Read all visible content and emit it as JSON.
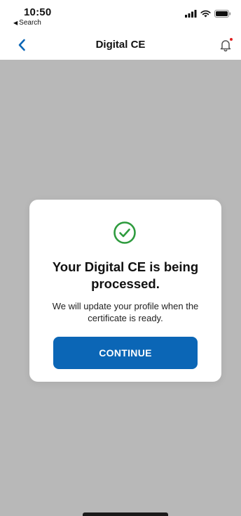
{
  "status_bar": {
    "time": "10:50",
    "back_to_app": "Search",
    "icons": [
      "signal-icon",
      "wifi-icon",
      "battery-icon"
    ]
  },
  "nav": {
    "title": "Digital CE",
    "back_icon": "chevron-left-icon",
    "bell_icon": "bell-icon",
    "has_notification": true
  },
  "modal": {
    "icon": "check-circle-icon",
    "title": "Your Digital CE is being processed.",
    "message": "We will update your profile when the certificate is ready.",
    "button_label": "CONTINUE"
  },
  "colors": {
    "accent": "#0b66b6",
    "success": "#2e9b3e",
    "overlay": "#b8b8b8",
    "notification_dot": "#e02020"
  }
}
